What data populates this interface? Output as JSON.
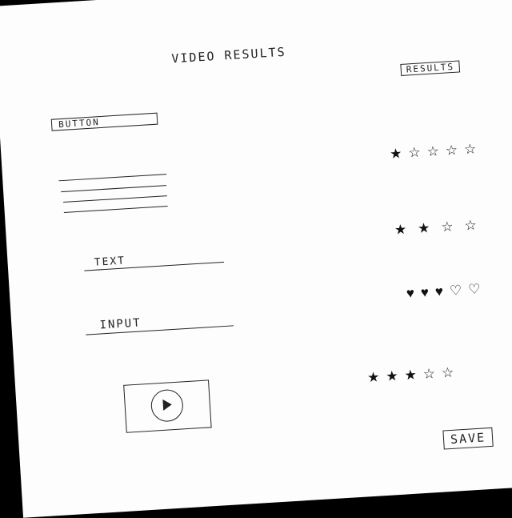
{
  "title": "VIDEO RESULTS",
  "results_label": "RESULTS",
  "button_label": "BUTTON",
  "text_label": "TEXT",
  "input_label": "INPUT",
  "save_label": "SAVE",
  "play_icon": "play-icon",
  "ratings": [
    {
      "icon": "star",
      "filled": 1,
      "total": 5
    },
    {
      "icon": "star",
      "filled": 2,
      "total": 4
    },
    {
      "icon": "heart",
      "filled": 3,
      "total": 5
    },
    {
      "icon": "star",
      "filled": 3,
      "total": 5
    }
  ]
}
